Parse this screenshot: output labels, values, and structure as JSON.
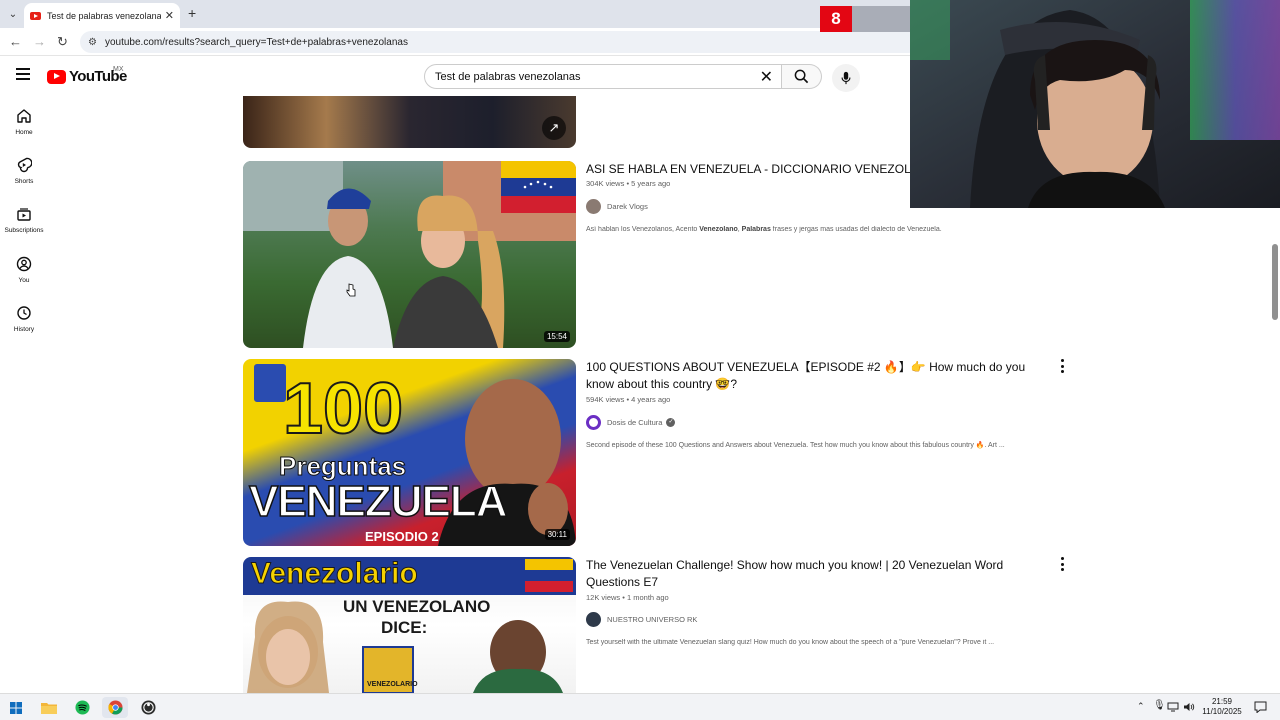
{
  "browser": {
    "tab_title": "Test de palabras venezolanas -",
    "url": "youtube.com/results?search_query=Test+de+palabras+venezolanas"
  },
  "overlay": {
    "counter": "8"
  },
  "youtube": {
    "logo_text": "YouTube",
    "country": "MX",
    "search_query": "Test de palabras venezolanas",
    "guide": [
      {
        "label": "Home",
        "icon": "home-icon"
      },
      {
        "label": "Shorts",
        "icon": "shorts-icon"
      },
      {
        "label": "Subscriptions",
        "icon": "subscriptions-icon"
      },
      {
        "label": "You",
        "icon": "you-icon"
      },
      {
        "label": "History",
        "icon": "history-icon"
      }
    ],
    "results": [
      {
        "title": "ASI SE HABLA EN VENEZUELA - DICCIONARIO VENEZOLANO",
        "views": "304K views",
        "age": "5 years ago",
        "channel": "Darek Vlogs",
        "desc_pre": "Así hablan los Venezolanos, Acento ",
        "desc_b1": "Venezolano",
        "desc_mid": ", ",
        "desc_b2": "Palabras",
        "desc_post": " frases y jergas mas usadas del dialecto de Venezuela.",
        "duration": "15:54"
      },
      {
        "title": "100 QUESTIONS ABOUT VENEZUELA【EPISODE #2 🔥】👉 How much do you know about this country 🤓?",
        "views": "594K views",
        "age": "4 years ago",
        "channel": "Dosis de Cultura",
        "verified": true,
        "desc": "Second episode of these 100 Questions and Answers about Venezuela. Test how much you know about this fabulous country 🔥. Art ...",
        "duration": "30:11",
        "thumb_big": "100",
        "thumb_mid": "Preguntas",
        "thumb_big2": "VENEZUELA",
        "thumb_ep": "EPISODIO 2"
      },
      {
        "title": "The Venezuelan Challenge! Show how much you know! | 20 Venezuelan Word Questions E7",
        "views": "12K views",
        "age": "1 month ago",
        "channel": "NUESTRO UNIVERSO RK",
        "desc": "Test yourself with the ultimate Venezuelan slang quiz! How much do you know about the speech of a \"pure Venezuelan\"? Prove it ...",
        "thumb_brand": "Venezolario",
        "thumb_line1": "UN VENEZOLANO",
        "thumb_line2": "DICE:",
        "thumb_book": "VENEZOLARIO"
      }
    ]
  },
  "taskbar": {
    "time": "21:59",
    "date": "11/10/2025"
  },
  "colors": {
    "yt_red": "#ff0000",
    "accent_red": "#e30613"
  }
}
